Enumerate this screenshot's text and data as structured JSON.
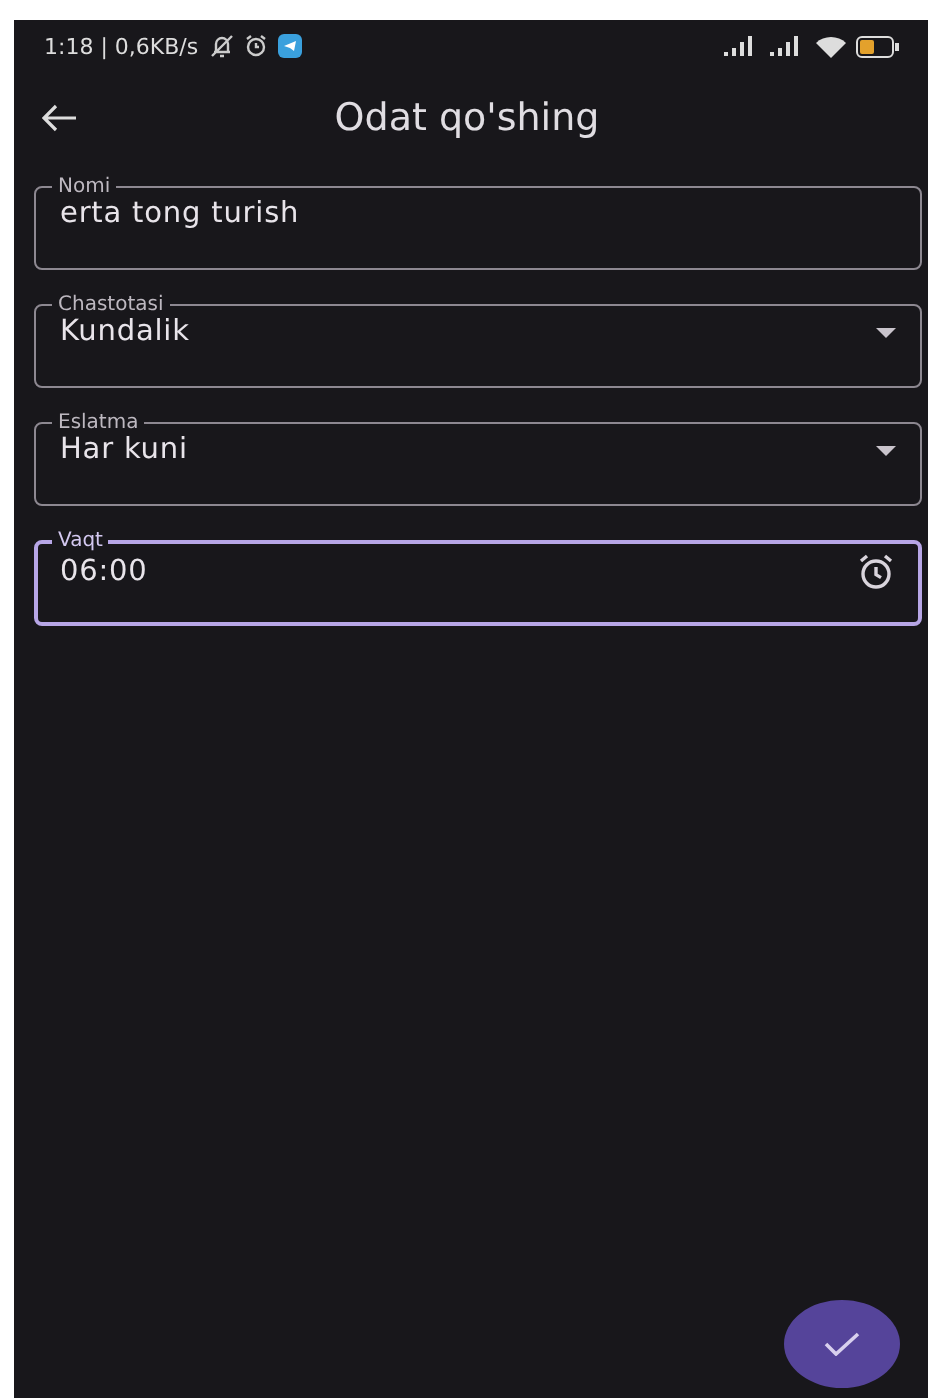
{
  "status_bar": {
    "text": "1:18 | 0,6KB/s"
  },
  "app_bar": {
    "title": "Odat qo'shing"
  },
  "fields": [
    {
      "kind": "text",
      "label": "Nomi",
      "value": "erta tong turish",
      "focused": false
    },
    {
      "kind": "dropdown",
      "label": "Chastotasi",
      "value": "Kundalik",
      "focused": false
    },
    {
      "kind": "dropdown",
      "label": "Eslatma",
      "value": "Har kuni",
      "focused": false
    },
    {
      "kind": "time",
      "label": "Vaqt",
      "value": "06:00",
      "focused": true
    }
  ]
}
